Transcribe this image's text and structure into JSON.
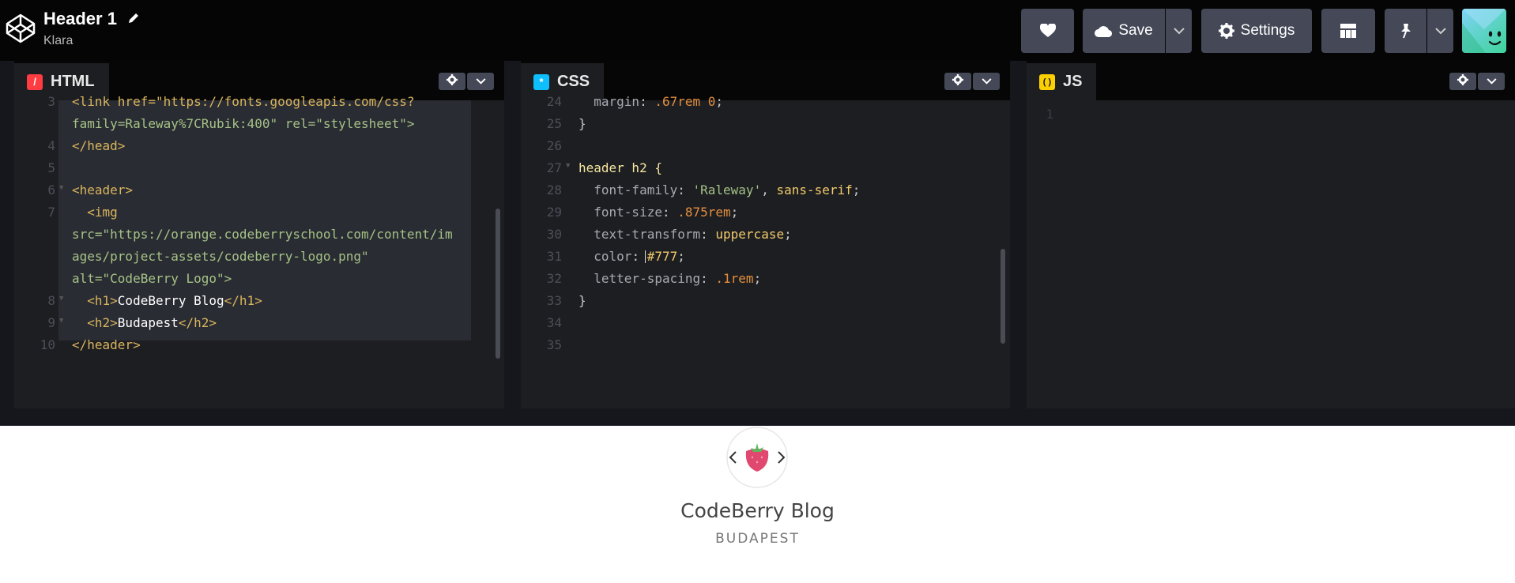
{
  "header": {
    "title": "Header 1",
    "user": "Klara",
    "save_label": "Save",
    "settings_label": "Settings"
  },
  "icons": [
    "codepen-logo-icon",
    "pencil-icon",
    "heart-icon",
    "cloud-icon",
    "chevron-down-icon",
    "gear-icon",
    "layout-icon",
    "pin-icon",
    "avatar",
    "cursor-icon"
  ],
  "panes": {
    "html": {
      "label": "HTML",
      "icon_glyph": "/",
      "color": "#ff3c41",
      "line_numbers": [
        "3",
        "4",
        "5",
        "6",
        "7",
        "8",
        "9",
        "10"
      ],
      "lines": {
        "l1a": "<link href=\"https://fonts.googleapis.com/css?",
        "l1b": "family=Raleway%7CRubik:400\" rel=\"stylesheet\">",
        "l2": "</head>",
        "l4": "<header>",
        "l5a": "  <img",
        "l5b": "src=\"https://orange.codeberryschool.com/content/im",
        "l5c": "ages/project-assets/codeberry-logo.png\"",
        "l5d": "alt=\"CodeBerry Logo\">",
        "l6_open": "  <h1>",
        "l6_text": "CodeBerry Blog",
        "l6_close": "</h1>",
        "l7_open": "  <h2>",
        "l7_text": "Budapest",
        "l7_close": "</h2>",
        "l8": "</header>"
      }
    },
    "css": {
      "label": "CSS",
      "icon_glyph": "*",
      "color": "#0ebeff",
      "line_numbers": [
        "24",
        "25",
        "26",
        "27",
        "28",
        "29",
        "30",
        "31",
        "32",
        "33",
        "34",
        "35"
      ],
      "lines": {
        "l24_prop": "  margin",
        "l24_colon": ": ",
        "l24_val": ".67rem 0",
        "l24_end": ";",
        "l25": "}",
        "l27": "header h2 {",
        "l28_prop": "  font-family",
        "l28_v1": "'Raleway'",
        "l28_v2": "sans-serif",
        "l29_prop": "  font-size",
        "l29_val": ".875rem",
        "l30_prop": "  text-transform",
        "l30_val": "uppercase",
        "l31_prop": "  color",
        "l31_val": "#777",
        "l32_prop": "  letter-spacing",
        "l32_val": ".1rem",
        "l33": "}"
      }
    },
    "js": {
      "label": "JS",
      "icon_glyph": "( )",
      "color": "#fcd000",
      "line_numbers": [
        "1"
      ]
    }
  },
  "preview": {
    "heading": "CodeBerry Blog",
    "subheading": "BUDAPEST"
  }
}
